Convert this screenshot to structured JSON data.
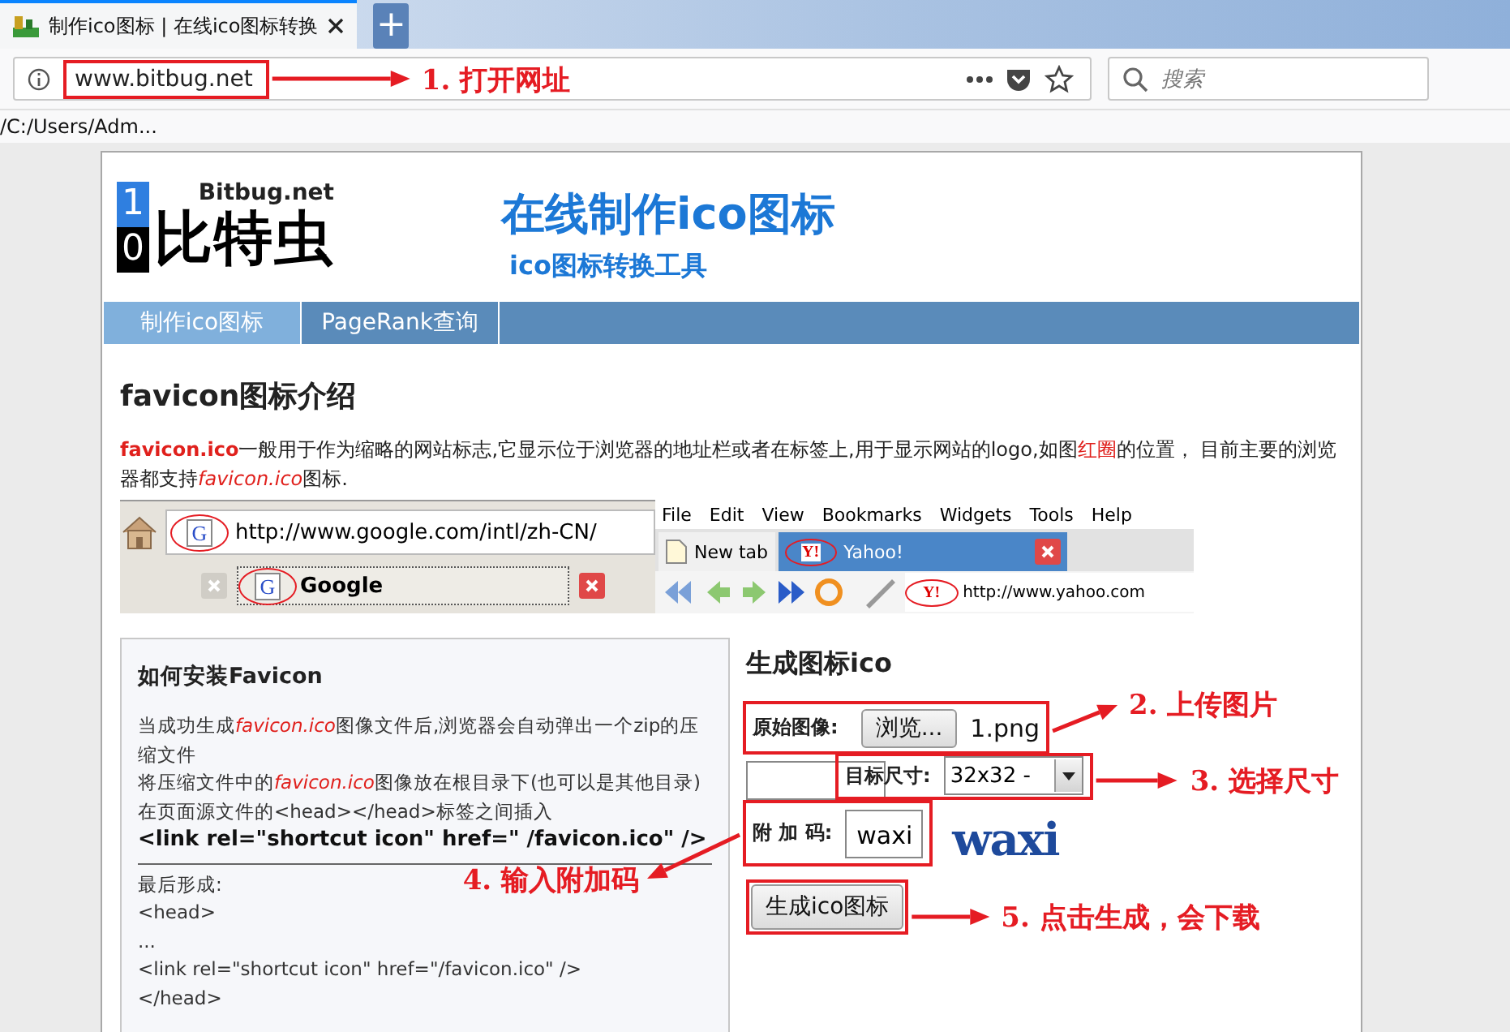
{
  "browser": {
    "tabs": [
      {
        "title": "制作ico图标 | 在线ico图标转换",
        "selected": true
      }
    ],
    "new_tab": "+",
    "address": {
      "url": "www.bitbug.net"
    },
    "search": {
      "placeholder": "搜索"
    },
    "status_text": "/C:/Users/Adm..."
  },
  "page": {
    "logo": {
      "digits": [
        "1",
        "0"
      ],
      "domain": "Bitbug.net",
      "name": "比特虫"
    },
    "title": "在线制作ico图标",
    "subtitle": "ico图标转换工具",
    "nav": [
      {
        "label": "制作ico图标",
        "selected": true
      },
      {
        "label": "PageRank查询",
        "selected": false
      }
    ],
    "intro": {
      "heading": "favicon图标介绍",
      "paragraph": [
        {
          "text": "favicon.ico",
          "kind": "keyword"
        },
        {
          "text": "一般用于作为缩略的网站标志,它显示位于浏览器的地址栏或者在标签上,用于显示网站的logo,如图",
          "kind": "plain"
        },
        {
          "text": "红圈",
          "kind": "marker"
        },
        {
          "text": "的位置， 目前主要的浏览器都支持",
          "kind": "plain"
        },
        {
          "text": "favicon.ico",
          "kind": "filename"
        },
        {
          "text": "图标.",
          "kind": "plain"
        }
      ]
    },
    "example": {
      "google": {
        "address": {
          "icon": "G",
          "url": "http://www.google.com/intl/zh-CN/"
        },
        "tab": {
          "icon": "G",
          "label": "Google"
        }
      },
      "other": {
        "menu": [
          "File",
          "Edit",
          "View",
          "Bookmarks",
          "Widgets",
          "Tools",
          "Help"
        ],
        "tabs": [
          {
            "label": "New tab",
            "selected": false
          },
          {
            "label": "Yahoo!",
            "icon": "Y!",
            "selected": true
          }
        ],
        "address": {
          "icon": "Y!",
          "url": "http://www.yahoo.com"
        }
      }
    },
    "install": {
      "heading": "如何安装Favicon",
      "lines": [
        [
          {
            "text": "当成功生成",
            "kind": "plain"
          },
          {
            "text": "favicon.ico",
            "kind": "filename"
          },
          {
            "text": "图像文件后,浏览器会自动弹出一个zip的压缩文件",
            "kind": "plain"
          }
        ],
        [
          {
            "text": "将压缩文件中的",
            "kind": "plain"
          },
          {
            "text": "favicon.ico",
            "kind": "filename"
          },
          {
            "text": "图像放在根目录下(也可以是其他目录)",
            "kind": "plain"
          }
        ],
        [
          {
            "text": "在页面源文件的<head></head>标签之间插入",
            "kind": "plain"
          }
        ]
      ],
      "code": "<link rel=\"shortcut icon\" href=\" /favicon.ico\" />",
      "result": [
        "最后形成:",
        "<head>",
        "...",
        "<link rel=\"shortcut icon\" href=\"/favicon.ico\" />",
        "</head>"
      ]
    },
    "generate": {
      "heading": "生成图标ico",
      "fields": [
        {
          "kind": "file",
          "label": "原始图像:",
          "button": "浏览...",
          "value": "1.png"
        },
        {
          "kind": "select",
          "label": "目标尺寸:",
          "value": "32x32 -"
        },
        {
          "kind": "text",
          "label": "附 加 码:",
          "value": "waxi",
          "captcha": "waxi"
        }
      ],
      "submit": "生成ico图标"
    }
  },
  "annotations": [
    "1. 打开网址",
    "2. 上传图片",
    "3. 选择尺寸",
    "4. 输入附加码",
    "5. 点击生成，会下载"
  ]
}
